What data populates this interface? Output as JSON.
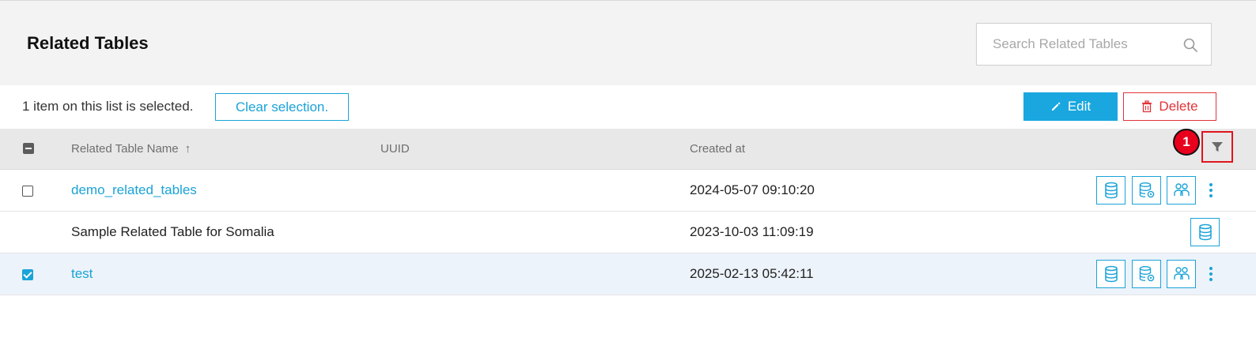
{
  "header": {
    "title": "Related Tables",
    "search_placeholder": "Search Related Tables",
    "search_value": ""
  },
  "selection_bar": {
    "status_text": "1 item on this list is selected.",
    "clear_label": "Clear selection.",
    "edit_label": "Edit",
    "delete_label": "Delete"
  },
  "table": {
    "columns": [
      "Related Table Name",
      "UUID",
      "Created at"
    ],
    "sort_column": "Related Table Name",
    "sort_direction": "ascending",
    "sort_indicator": "↑",
    "filter_badge": "1",
    "rows": [
      {
        "name": "demo_related_tables",
        "uuid": "",
        "created_at": "2024-05-07 09:10:20",
        "selectable": true,
        "checked": false,
        "is_link": true,
        "actions": [
          "database-icon",
          "database-settings-icon",
          "users-group-icon"
        ],
        "has_more_menu": true
      },
      {
        "name": "Sample Related Table for Somalia",
        "uuid": "",
        "created_at": "2023-10-03 11:09:19",
        "selectable": false,
        "checked": false,
        "is_link": false,
        "actions": [
          "database-icon"
        ],
        "has_more_menu": false
      },
      {
        "name": "test",
        "uuid": "",
        "created_at": "2025-02-13 05:42:11",
        "selectable": true,
        "checked": true,
        "is_link": true,
        "actions": [
          "database-icon",
          "database-settings-icon",
          "users-group-icon"
        ],
        "has_more_menu": true
      }
    ]
  },
  "colors": {
    "accent": "#1aa3d8",
    "danger": "#e0343a",
    "selected_row": "#edf3fa",
    "header_bg": "#f3f3f3"
  }
}
